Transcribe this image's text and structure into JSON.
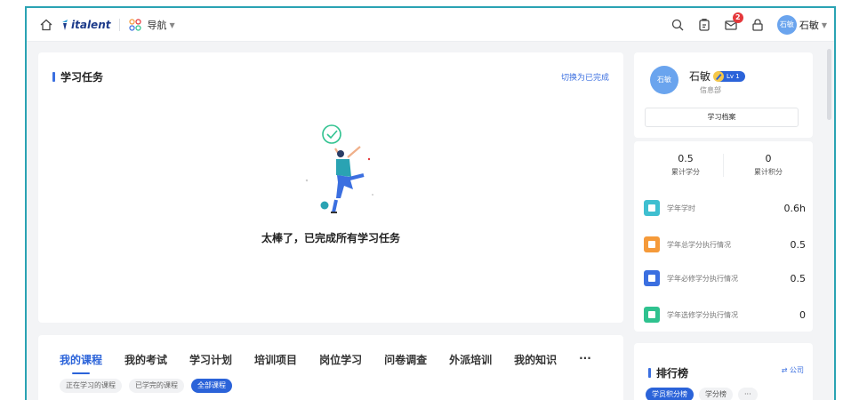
{
  "topbar": {
    "logo_text": "italent",
    "nav_label": "导航",
    "notification_count": "2",
    "user_avatar": "石敏",
    "user_name": "石敏"
  },
  "task": {
    "title": "学习任务",
    "switch_label": "切换为已完成",
    "empty_message": "太棒了，已完成所有学习任务"
  },
  "courses": {
    "tabs": [
      "我的课程",
      "我的考试",
      "学习计划",
      "培训项目",
      "岗位学习",
      "问卷调查",
      "外派培训",
      "我的知识",
      "···"
    ],
    "subtabs": [
      "正在学习的课程",
      "已学完的课程",
      "全部课程"
    ]
  },
  "profile": {
    "avatar_text": "石敏",
    "name": "石敏",
    "level": "Lv 1",
    "dept": "信息部",
    "archive_button": "学习档案"
  },
  "stats": {
    "credit_value": "0.5",
    "credit_label": "累计学分",
    "points_value": "0",
    "points_label": "累计积分",
    "metrics": [
      {
        "label": "学年学时",
        "value": "0.6h",
        "color": "#3fbfd0",
        "icon": "monitor-icon"
      },
      {
        "label": "学年总学分执行情况",
        "value": "0.5",
        "color": "#f59a3a",
        "icon": "check-square-icon"
      },
      {
        "label": "学年必修学分执行情况",
        "value": "0.5",
        "color": "#3b6fe0",
        "icon": "bookmark-icon"
      },
      {
        "label": "学年选修学分执行情况",
        "value": "0",
        "color": "#2fc28f",
        "icon": "heart-icon"
      }
    ]
  },
  "ranking": {
    "title": "排行榜",
    "scope": "⇄ 公司",
    "chips": [
      "学员积分榜",
      "学分榜",
      "···"
    ]
  },
  "colors": {
    "accent": "#2b63d9",
    "frame": "#2aa3b3"
  }
}
